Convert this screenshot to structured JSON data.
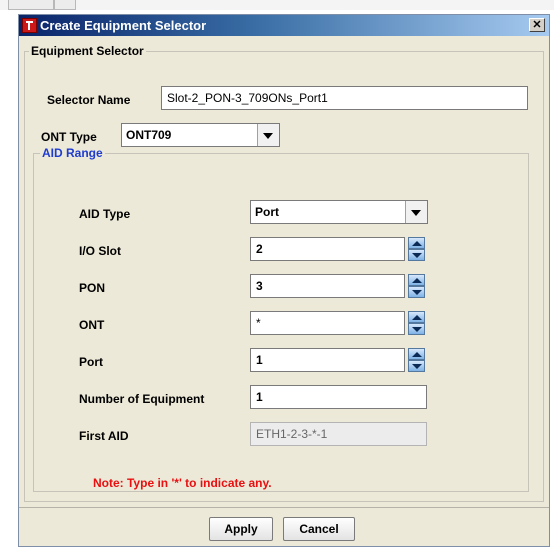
{
  "dialog": {
    "title": "Create Equipment Selector",
    "close_glyph": "✕"
  },
  "equipment_selector": {
    "legend": "Equipment Selector",
    "selector_name_label": "Selector Name",
    "selector_name_value": "Slot-2_PON-3_709ONs_Port1",
    "ont_type_label": "ONT Type",
    "ont_type_value": "ONT709"
  },
  "aid_range": {
    "legend": "AID Range",
    "aid_type_label": "AID Type",
    "aid_type_value": "Port",
    "io_slot_label": "I/O Slot",
    "io_slot_value": "2",
    "pon_label": "PON",
    "pon_value": "3",
    "ont_label": "ONT",
    "ont_value": "*",
    "port_label": "Port",
    "port_value": "1",
    "num_equipment_label": "Number of Equipment",
    "num_equipment_value": "1",
    "first_aid_label": "First AID",
    "first_aid_value": "ETH1-2-3-*-1",
    "note": "Note: Type in '*' to indicate any."
  },
  "buttons": {
    "apply": "Apply",
    "cancel": "Cancel"
  },
  "colors": {
    "title_gradient_start": "#0a246a",
    "title_gradient_end": "#a6caf0",
    "aid_legend": "#1f3ccf",
    "note": "#e81010",
    "dialog_bg": "#ece9d8"
  },
  "icons": {
    "app": "app-logo-icon",
    "close": "close-icon",
    "dropdown": "chevron-down-icon",
    "spinner": "spinner-arrows-icon"
  }
}
